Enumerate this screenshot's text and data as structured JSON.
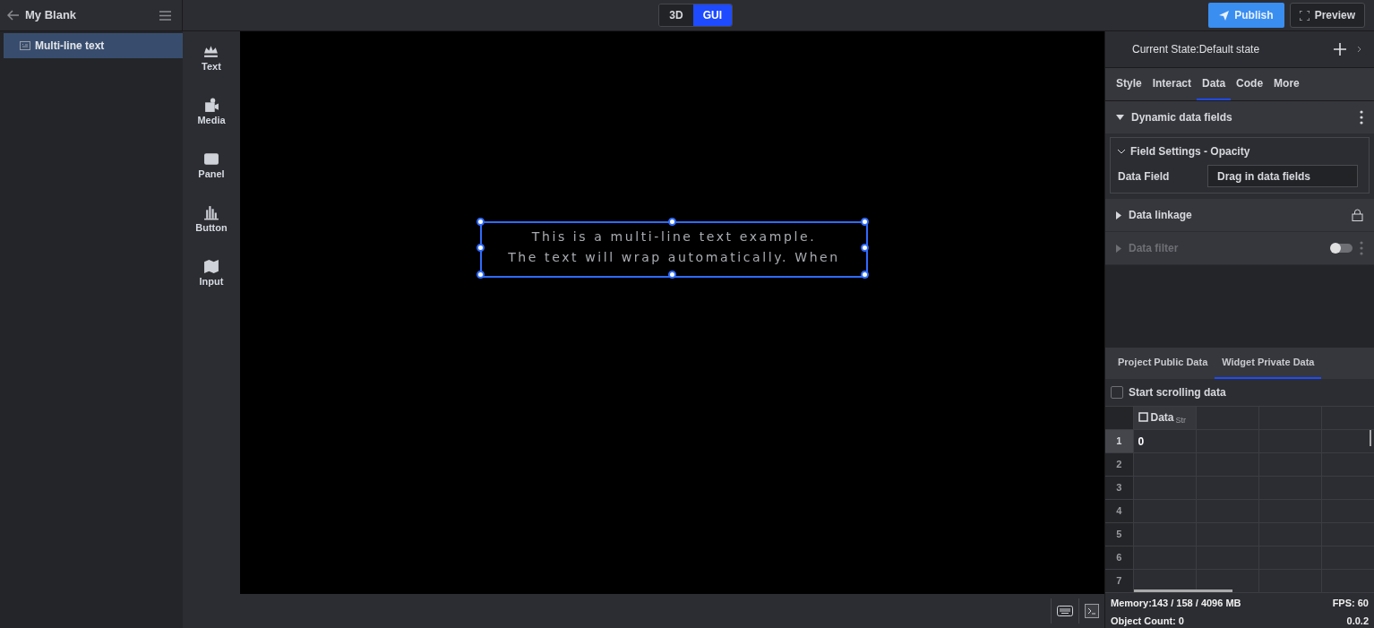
{
  "project": {
    "title": "My Blank"
  },
  "layers": [
    {
      "label": "Multi-line text",
      "selected": true
    }
  ],
  "mode_toggle": [
    {
      "label": "3D",
      "selected": false
    },
    {
      "label": "GUI",
      "selected": true
    }
  ],
  "actions": {
    "publish": "Publish",
    "preview": "Preview"
  },
  "widgets": [
    {
      "label": "Text",
      "kind": "text"
    },
    {
      "label": "Media",
      "kind": "media"
    },
    {
      "label": "Panel",
      "kind": "panel"
    },
    {
      "label": "Button",
      "kind": "button"
    },
    {
      "label": "Input",
      "kind": "input"
    }
  ],
  "canvas": {
    "text_lines": [
      "This is a multi-line text example.",
      "The text will wrap automatically. When"
    ]
  },
  "inspector": {
    "state_label": "Current State:Default state",
    "tabs": [
      {
        "label": "Style",
        "selected": false
      },
      {
        "label": "Interact",
        "selected": false
      },
      {
        "label": "Data",
        "selected": true
      },
      {
        "label": "Code",
        "selected": false
      },
      {
        "label": "More",
        "selected": false
      }
    ],
    "sections": [
      {
        "title": "Dynamic data fields",
        "kind": "fields",
        "expanded": true,
        "disabled": false
      },
      {
        "title": "Data linkage",
        "kind": "linkage",
        "expanded": false,
        "disabled": false
      },
      {
        "title": "Data filter",
        "kind": "filter",
        "expanded": false,
        "disabled": true,
        "on": false
      }
    ],
    "field_settings": {
      "title": "Field Settings - Opacity",
      "expanded": true,
      "label": "Data Field",
      "placeholder": "Drag in data fields"
    }
  },
  "data_tabs": [
    {
      "label": "Project Public Data",
      "selected": false
    },
    {
      "label": "Widget Private Data",
      "selected": true
    }
  ],
  "scrolling": {
    "label": "Start scrolling data",
    "checked": false
  },
  "table": {
    "columns": [
      {
        "label": "Data",
        "type_label": "Str"
      },
      {},
      {},
      {}
    ],
    "rows": [
      {
        "number": "1",
        "cells": [
          "0"
        ],
        "selected": true
      },
      {
        "number": "2",
        "cells": [],
        "selected": false
      },
      {
        "number": "3",
        "cells": [],
        "selected": false
      },
      {
        "number": "4",
        "cells": [],
        "selected": false
      },
      {
        "number": "5",
        "cells": [],
        "selected": false
      },
      {
        "number": "6",
        "cells": [],
        "selected": false
      },
      {
        "number": "7",
        "cells": [],
        "selected": false
      }
    ]
  },
  "status": {
    "memory": "Memory:143 / 158 / 4096 MB",
    "fps": "FPS: 60",
    "objects": "Object Count: 0",
    "version": "0.0.2"
  }
}
